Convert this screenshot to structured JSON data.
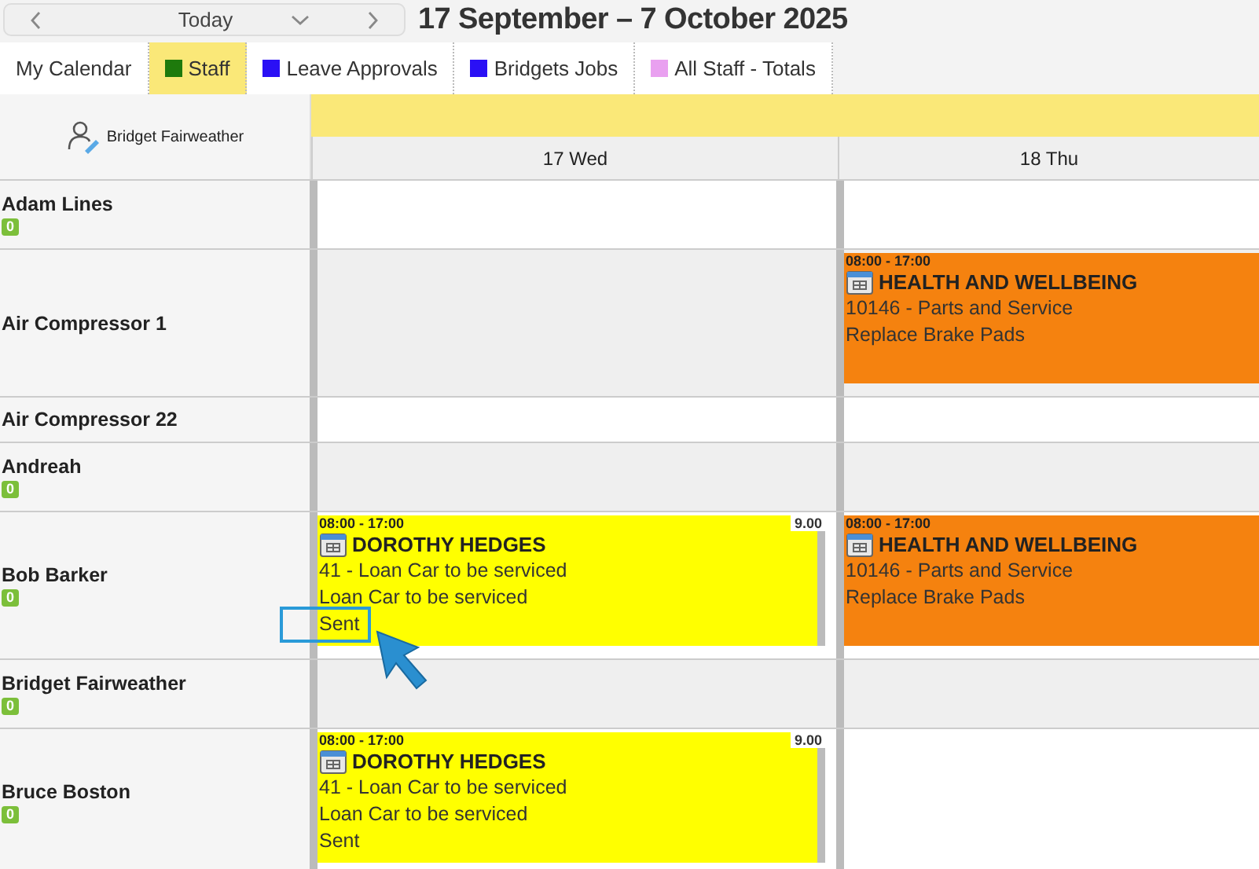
{
  "toolbar": {
    "today": "Today",
    "range_title": "17 September – 7 October 2025"
  },
  "tabs": [
    {
      "label": "My Calendar",
      "selected": false
    },
    {
      "label": "Staff",
      "selected": true,
      "color": "#1e7a0c"
    },
    {
      "label": "Leave Approvals",
      "selected": false,
      "color": "#2a10f5"
    },
    {
      "label": "Bridgets Jobs",
      "selected": false,
      "color": "#2a10f5"
    },
    {
      "label": "All Staff - Totals",
      "selected": false,
      "color": "#e9a0f0"
    }
  ],
  "header": {
    "user": "Bridget Fairweather",
    "days": [
      "17 Wed",
      "18 Thu"
    ]
  },
  "rows": [
    {
      "name": "Adam Lines",
      "badge": "0",
      "cells": [
        null,
        null
      ]
    },
    {
      "name": "Air Compressor 1",
      "cells": [
        null,
        {
          "time": "08:00 - 17:00",
          "title": "HEALTH AND WELLBEING",
          "lines": [
            "10146 - Parts and Service",
            "Replace Brake Pads"
          ],
          "color": "#f5820f"
        }
      ]
    },
    {
      "name": "Air Compressor 22",
      "cells": [
        null,
        null
      ]
    },
    {
      "name": "Andreah",
      "badge": "0",
      "cells": [
        null,
        null
      ]
    },
    {
      "name": "Bob Barker",
      "badge": "0",
      "cells": [
        {
          "time": "08:00 - 17:00",
          "title": "DOROTHY HEDGES",
          "lines": [
            "41 - Loan Car to be serviced",
            "Loan Car to be serviced",
            "Sent"
          ],
          "hours": "9.00",
          "color": "#ffff00"
        },
        {
          "time": "08:00 - 17:00",
          "title": "HEALTH AND WELLBEING",
          "lines": [
            "10146 - Parts and Service",
            "Replace Brake Pads"
          ],
          "color": "#f5820f"
        }
      ]
    },
    {
      "name": "Bridget Fairweather",
      "badge": "0",
      "cells": [
        null,
        null
      ]
    },
    {
      "name": "Bruce Boston",
      "badge": "0",
      "cells": [
        {
          "time": "08:00 - 17:00",
          "title": "DOROTHY HEDGES",
          "lines": [
            "41 - Loan Car to be serviced",
            "Loan Car to be serviced",
            "Sent"
          ],
          "hours": "9.00",
          "color": "#ffff00"
        },
        null
      ]
    }
  ]
}
